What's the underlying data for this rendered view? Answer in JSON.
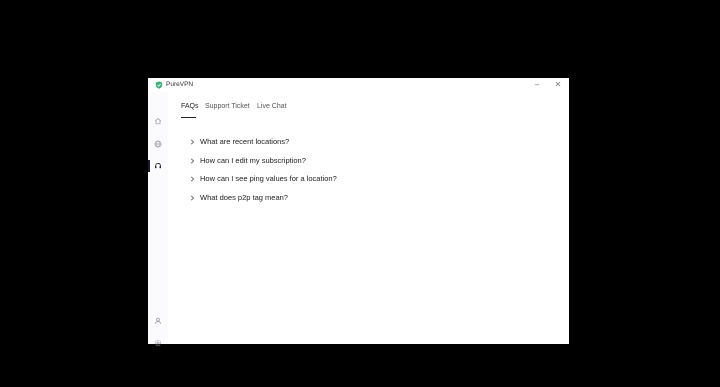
{
  "window": {
    "title": "PureVPN",
    "minimize_symbol": "–",
    "close_symbol": "✕"
  },
  "sidebar": {
    "items": [
      {
        "icon": "home-icon",
        "active": false
      },
      {
        "icon": "globe-icon",
        "active": false
      },
      {
        "icon": "headset-icon",
        "active": true
      },
      {
        "icon": "user-icon",
        "active": false
      },
      {
        "icon": "gear-icon",
        "active": false
      }
    ]
  },
  "tabs": [
    {
      "label": "FAQs",
      "active": true
    },
    {
      "label": "Support Ticket",
      "active": false
    },
    {
      "label": "Live Chat",
      "active": false
    }
  ],
  "faqs": [
    {
      "question": "What are recent locations?"
    },
    {
      "question": "How can I edit my subscription?"
    },
    {
      "question": "How can I see ping values for a location?"
    },
    {
      "question": "What does p2p tag mean?"
    }
  ],
  "colors": {
    "brand": "#3bb273",
    "active_indicator": "#1a1a2e",
    "text": "#222222",
    "muted": "#555555"
  }
}
